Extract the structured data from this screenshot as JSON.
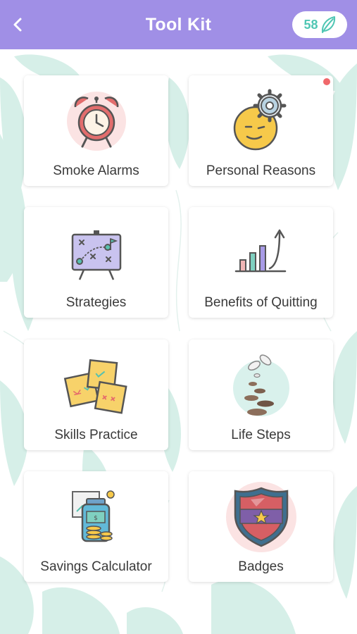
{
  "header": {
    "title": "Tool Kit",
    "back_icon": "chevron-left-icon",
    "points": "58",
    "points_icon": "leaf-icon"
  },
  "colors": {
    "header_bg": "#a08fe6",
    "accent": "#4fc6b3",
    "notification": "#f0686b"
  },
  "cards": [
    {
      "label": "Smoke Alarms",
      "icon": "alarm-clock-icon"
    },
    {
      "label": "Personal Reasons",
      "icon": "thinking-face-gear-icon",
      "has_notification": true
    },
    {
      "label": "Strategies",
      "icon": "strategy-board-icon"
    },
    {
      "label": "Benefits of Quitting",
      "icon": "growth-chart-icon"
    },
    {
      "label": "Skills Practice",
      "icon": "sticky-notes-icon"
    },
    {
      "label": "Life Steps",
      "icon": "stepping-stones-icon"
    },
    {
      "label": "Savings Calculator",
      "icon": "savings-jar-icon"
    },
    {
      "label": "Badges",
      "icon": "shield-badge-icon"
    }
  ]
}
